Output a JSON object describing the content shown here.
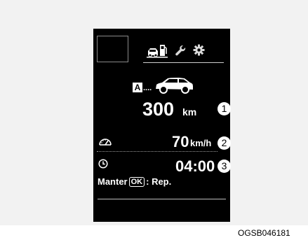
{
  "panel": {
    "mode_badge": "A",
    "mode_dots": "....",
    "range_value": "300",
    "range_unit": "km",
    "speed_value": "70",
    "speed_unit": "km/h",
    "time_value": "04:00",
    "hint_prefix": "Manter",
    "hint_key": "OK",
    "hint_suffix": ": Rep.",
    "tab_icons": [
      "car-fuel-icon",
      "wrench-icon",
      "gear-icon"
    ],
    "row_icons": [
      "speedometer-icon",
      "clock-icon"
    ]
  },
  "callouts": [
    "1",
    "2",
    "3"
  ],
  "caption": "OGSB046181",
  "colors": {
    "panel_bg": "#000000",
    "text": "#ffffff",
    "page_bg": "#f2f2f2"
  }
}
